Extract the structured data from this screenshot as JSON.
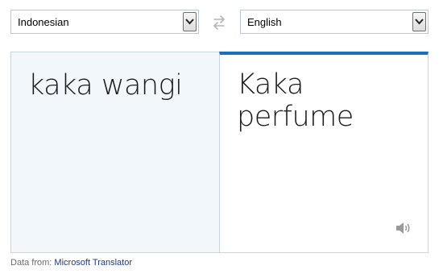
{
  "source_language": {
    "value": "Indonesian"
  },
  "target_language": {
    "value": "English"
  },
  "source_text": "kaka wangi",
  "translated_text": "Kaka perfume",
  "footer": {
    "prefix": "Data from:",
    "link": "Microsoft Translator"
  },
  "icons": {
    "swap": "swap-arrows-icon",
    "speaker": "speaker-icon",
    "dropdown": "chevron-down-icon"
  },
  "colors": {
    "accent": "#1e6fb9",
    "source_pane_bg": "#f2f7fb",
    "link": "#1a3a8a"
  }
}
